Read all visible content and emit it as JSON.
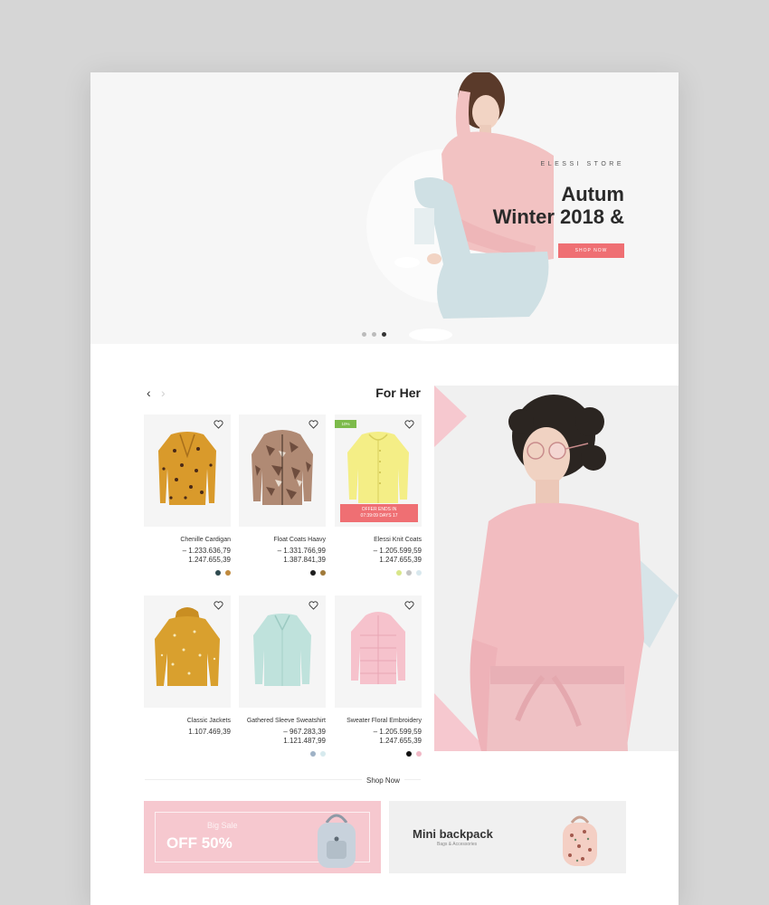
{
  "hero": {
    "eyebrow": "ELESSI STORE",
    "title_line1": "Autum",
    "title_line2": "Winter 2018 &",
    "button_label": "SHOP NOW",
    "slides": 3,
    "active_slide": 3
  },
  "section": {
    "title": "For Her",
    "prev_arrow": "‹",
    "next_arrow": "›",
    "shop_now": "Shop Now"
  },
  "products": [
    {
      "name": "Chenille Cardigan",
      "price1": "– 1.233.636,79",
      "price2": "1.247.655,39",
      "swatches": [
        "#2f4a4f",
        "#c08a3e"
      ],
      "image": "cardigan-mustard-hearts"
    },
    {
      "name": "Float Coats Haavy",
      "price1": "– 1.331.766,99",
      "price2": "1.387.841,39",
      "swatches": [
        "#1e1e1e",
        "#a07a3a"
      ],
      "image": "camo-jacket"
    },
    {
      "name": "Elessi Knit Coats",
      "price1": "– 1.205.599,59",
      "price2": "1.247.655,39",
      "swatches": [
        "#d8e68a",
        "#c4c4c4",
        "#d8e8ee"
      ],
      "image": "yellow-cardigan",
      "badge": "10%",
      "offer": "OFFER ENDS IN",
      "offer_timer": "07:39:09 DAYS 17"
    },
    {
      "name": "Classic Jackets",
      "price1": "1.107.469,39",
      "price2": "",
      "swatches": [],
      "image": "mustard-hoodie"
    },
    {
      "name": "Gathered Sleeve Sweatshirt",
      "price1": "– 967.283,39",
      "price2": "1.121.487,99",
      "swatches": [
        "#9fb2c6",
        "#d7eaee"
      ],
      "image": "mint-blouse"
    },
    {
      "name": "Sweater Floral Embroidery",
      "price1": "– 1.205.599,59",
      "price2": "1.247.655,39",
      "swatches": [
        "#111111",
        "#f0b8c6"
      ],
      "image": "pink-puffer"
    }
  ],
  "banners": [
    {
      "sub": "Big Sale",
      "main": "OFF 50%",
      "image": "grey-backpack"
    },
    {
      "title": "Mini backpack",
      "category": "Bags & Accessories",
      "image": "floral-backpack"
    }
  ],
  "colors": {
    "accent": "#ef6f73",
    "hero_bg": "#f6f6f6",
    "pink_banner": "#f6c8cf",
    "grey_banner": "#f0f0f0",
    "badge_green": "#7dbb4b"
  }
}
